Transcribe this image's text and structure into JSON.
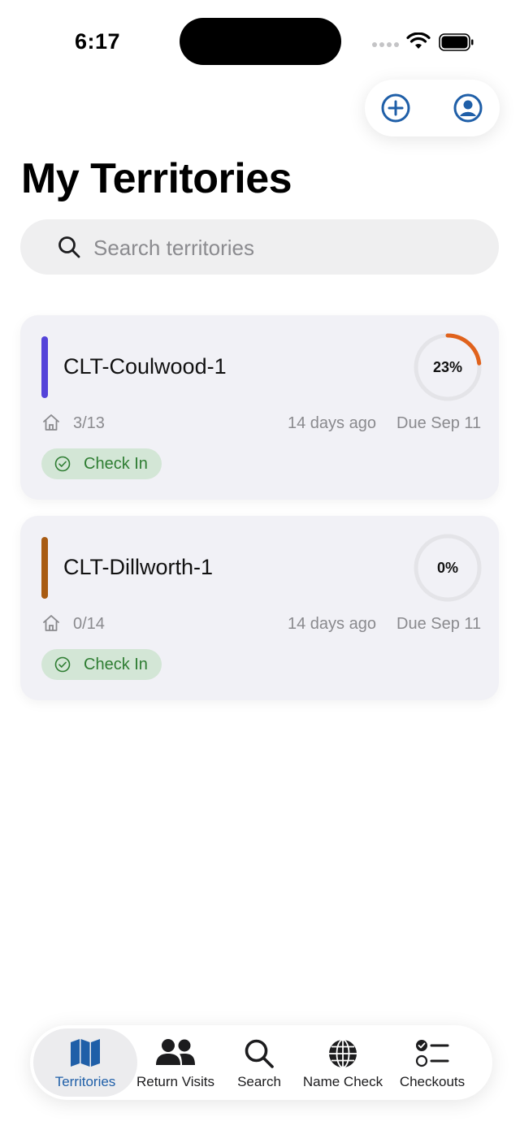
{
  "status_bar": {
    "time": "6:17"
  },
  "header": {
    "title": "My Territories"
  },
  "top_actions": {
    "add_icon": "plus-circle-icon",
    "profile_icon": "person-circle-icon"
  },
  "search": {
    "placeholder": "Search territories",
    "value": ""
  },
  "territories": [
    {
      "name": "CLT-Coulwood-1",
      "stripe_color": "#5443d9",
      "progress": 0.23,
      "progress_label": "23%",
      "progress_color": "#e0621c",
      "houses": "3/13",
      "last_worked": "14 days ago",
      "due": "Due Sep 11",
      "checkin_label": "Check In"
    },
    {
      "name": "CLT-Dillworth-1",
      "stripe_color": "#a85b12",
      "progress": 0.0,
      "progress_label": "0%",
      "progress_color": "#e0621c",
      "houses": "0/14",
      "last_worked": "14 days ago",
      "due": "Due Sep 11",
      "checkin_label": "Check In"
    }
  ],
  "tabbar": {
    "tabs": [
      {
        "label": "Territories",
        "icon": "map-icon",
        "active": true
      },
      {
        "label": "Return Visits",
        "icon": "people-icon",
        "active": false
      },
      {
        "label": "Search",
        "icon": "search-icon",
        "active": false
      },
      {
        "label": "Name Check",
        "icon": "globe-icon",
        "active": false
      },
      {
        "label": "Checkouts",
        "icon": "checklist-icon",
        "active": false
      }
    ]
  },
  "colors": {
    "accent": "#1f5fa8",
    "checkin_bg": "#d3e6d6",
    "checkin_text": "#2e7d32",
    "card_bg": "#f1f1f6"
  }
}
